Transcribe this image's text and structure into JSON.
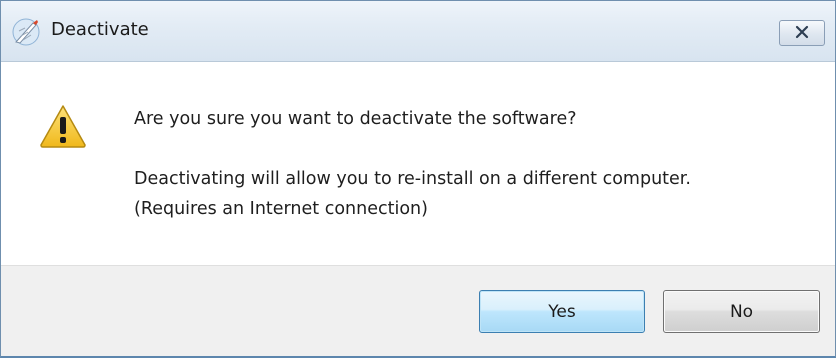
{
  "window": {
    "title": "Deactivate",
    "app_icon": "feather-pen-icon",
    "close_icon": "close-icon"
  },
  "message": {
    "question": "Are you sure you want to deactivate the software?",
    "detail_line1": "Deactivating will allow you to re-install on a different computer.",
    "detail_line2": "(Requires an Internet connection)",
    "icon": "warning-icon",
    "icon_color": "#f5c518"
  },
  "buttons": {
    "yes_label": "Yes",
    "no_label": "No"
  }
}
